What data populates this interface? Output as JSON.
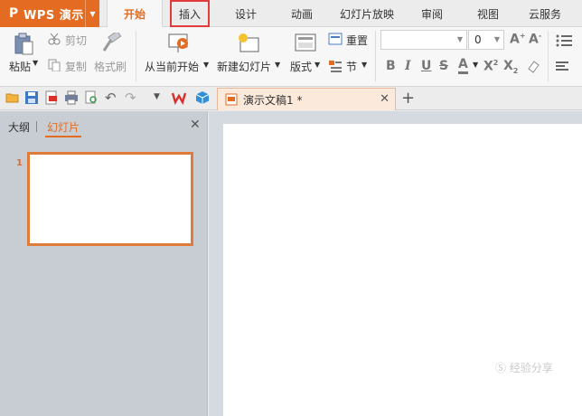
{
  "app": {
    "name": "WPS 演示",
    "logo": "P"
  },
  "tabs": [
    {
      "label": "开始"
    },
    {
      "label": "插入"
    },
    {
      "label": "设计"
    },
    {
      "label": "动画"
    },
    {
      "label": "幻灯片放映"
    },
    {
      "label": "审阅"
    },
    {
      "label": "视图"
    },
    {
      "label": "云服务"
    }
  ],
  "ribbon": {
    "paste": "粘贴",
    "cut": "剪切",
    "copy": "复制",
    "format_painter": "格式刷",
    "play_from_current": "从当前开始",
    "new_slide": "新建幻灯片",
    "layout": "版式",
    "reset": "重置",
    "section": "节",
    "font_size": "0"
  },
  "document_tab": {
    "title": "演示文稿1 *"
  },
  "left_pane": {
    "outline_tab": "大纲",
    "slides_tab": "幻灯片",
    "slide_number": "1"
  },
  "watermark": "Ⓢ 经验分享",
  "colors": {
    "accent": "#e36c22",
    "highlight": "#e23b3b"
  }
}
